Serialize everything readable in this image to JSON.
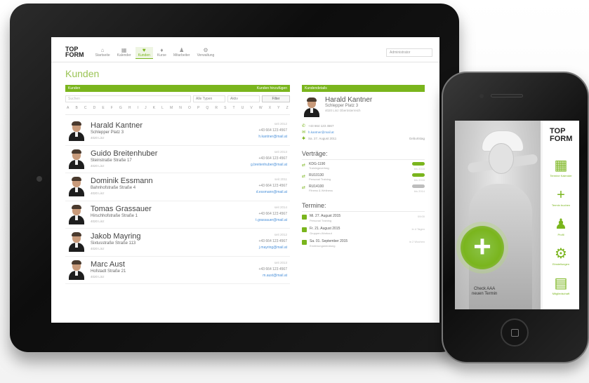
{
  "tablet": {
    "logo_top": "TOP",
    "logo_bottom": "FORM",
    "nav": [
      {
        "label": "Startseite",
        "icon": "⌂"
      },
      {
        "label": "Kalender",
        "icon": "▦"
      },
      {
        "label": "Kunden",
        "icon": "♥"
      },
      {
        "label": "Kurse",
        "icon": "♦"
      },
      {
        "label": "Mitarbeiter",
        "icon": "♟"
      },
      {
        "label": "Verwaltung",
        "icon": "⚙"
      }
    ],
    "user_select": "Administrator",
    "page_title": "Kunden",
    "list_bar_left": "Kunden",
    "list_bar_right": "Kunden hinzufügen",
    "filter": {
      "search_placeholder": "Suchen",
      "type_drop": "Alle Typen",
      "status_drop": "Aktiv",
      "button": "Filter"
    },
    "alphabet": [
      "A",
      "B",
      "C",
      "D",
      "E",
      "F",
      "G",
      "H",
      "I",
      "J",
      "K",
      "L",
      "M",
      "N",
      "O",
      "P",
      "Q",
      "R",
      "S",
      "T",
      "U",
      "V",
      "W",
      "X",
      "Y",
      "Z"
    ],
    "customers": [
      {
        "name": "Harald Kantner",
        "street": "Schlepper Platz 3",
        "city": "4020 Linz",
        "r1": "seit 2012",
        "phone": "+43 664 123 4567",
        "mail": "h.kantner@mail.at"
      },
      {
        "name": "Guido Breitenhuber",
        "street": "Steinstraße Straße 17",
        "city": "4020 Linz",
        "r1": "seit 2013",
        "phone": "+43 664 123 4567",
        "mail": "g.breitenhuber@mail.at"
      },
      {
        "name": "Dominik Essmann",
        "street": "Bahnhofstraße Straße 4",
        "city": "4020 Linz",
        "r1": "seit 2011",
        "phone": "+43 664 123 4567",
        "mail": "d.essmann@mail.at"
      },
      {
        "name": "Tomas Grassauer",
        "street": "Hirschhofstraße Straße 1",
        "city": "4020 Linz",
        "r1": "seit 2014",
        "phone": "+43 664 123 4567",
        "mail": "t.grassauer@mail.at"
      },
      {
        "name": "Jakob Mayring",
        "street": "Sixtusstraße Straße 113",
        "city": "4020 Linz",
        "r1": "seit 2012",
        "phone": "+43 664 123 4567",
        "mail": "j.mayring@mail.at"
      },
      {
        "name": "Marc Aust",
        "street": "Hofstadt Straße 21",
        "city": "4020 Linz",
        "r1": "seit 2013",
        "phone": "+43 664 123 4567",
        "mail": "m.aust@mail.at"
      }
    ],
    "detail": {
      "bar": "Kundendetails",
      "name": "Harald Kantner",
      "street": "Schlepper Platz 3",
      "city": "4020 Linz Oberösterreich",
      "phone": "+43 664 123 4567",
      "mail": "h.kantner@mail.at",
      "birthday": "Sa. 27. August 2011",
      "birthday_right": "Geburtstag",
      "contracts_title": "Verträge:",
      "contracts": [
        {
          "code": "KDG-1190",
          "sub": "Trainingsvertrag",
          "right": "bis 2016",
          "active": true
        },
        {
          "code": "RU10130",
          "sub": "Personal Training",
          "right": "bis 2016",
          "active": true
        },
        {
          "code": "RU14100",
          "sub": "Fitness & Wellness",
          "right": "bis 2014",
          "active": false
        }
      ],
      "appointments_title": "Termine:",
      "appointments": [
        {
          "date": "Mi. 27. August 2015",
          "sub": "Personal Training",
          "right": "09:00"
        },
        {
          "date": "Fr. 21. August 2015",
          "sub": "Gruppen-Workout",
          "right": "in 4 Tagen"
        },
        {
          "date": "Sa. 01. September 2015",
          "sub": "Ernährungsberatung",
          "right": "in 2 Wochen"
        }
      ]
    }
  },
  "phone": {
    "logo_top": "TOP",
    "logo_bottom": "FORM",
    "caption_line1": "Check AAA",
    "caption_line2": "neuen Termin",
    "plus": "+",
    "menu": [
      {
        "label": "Termine Kalender",
        "icon": "▦"
      },
      {
        "label": "Termin buchen",
        "icon": "+"
      },
      {
        "label": "Profil",
        "icon": "♟"
      },
      {
        "label": "Einstellungen",
        "icon": "⚙"
      },
      {
        "label": "Mitgliedschaft",
        "icon": "▤"
      }
    ]
  },
  "colors": {
    "accent": "#7ab51d",
    "link": "#4a90d9"
  }
}
